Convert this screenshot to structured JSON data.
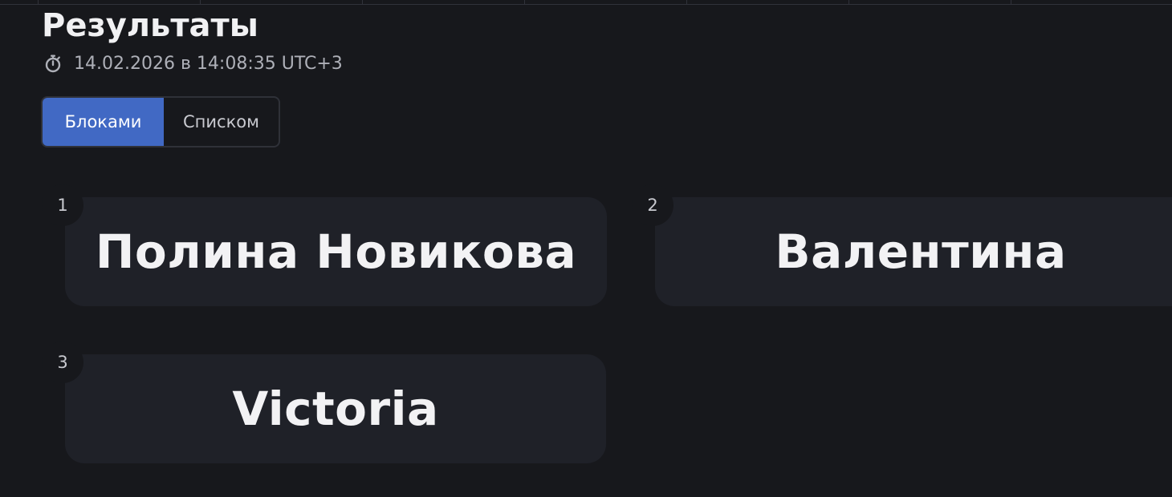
{
  "page": {
    "title": "Результаты",
    "timestamp": "14.02.2026 в 14:08:35 UTC+3",
    "timestamp_icon": "stopwatch-icon"
  },
  "view_toggle": {
    "blocks_label": "Блоками",
    "list_label": "Списком",
    "active": "blocks"
  },
  "results": [
    {
      "rank": "1",
      "name": "Полина Новикова"
    },
    {
      "rank": "2",
      "name": "Валентина"
    },
    {
      "rank": "3",
      "name": "Victoria"
    }
  ],
  "colors": {
    "background": "#17181c",
    "card": "#1f2128",
    "accent": "#4169c4",
    "text": "#f2f2f4",
    "muted": "#aeb0b8"
  }
}
